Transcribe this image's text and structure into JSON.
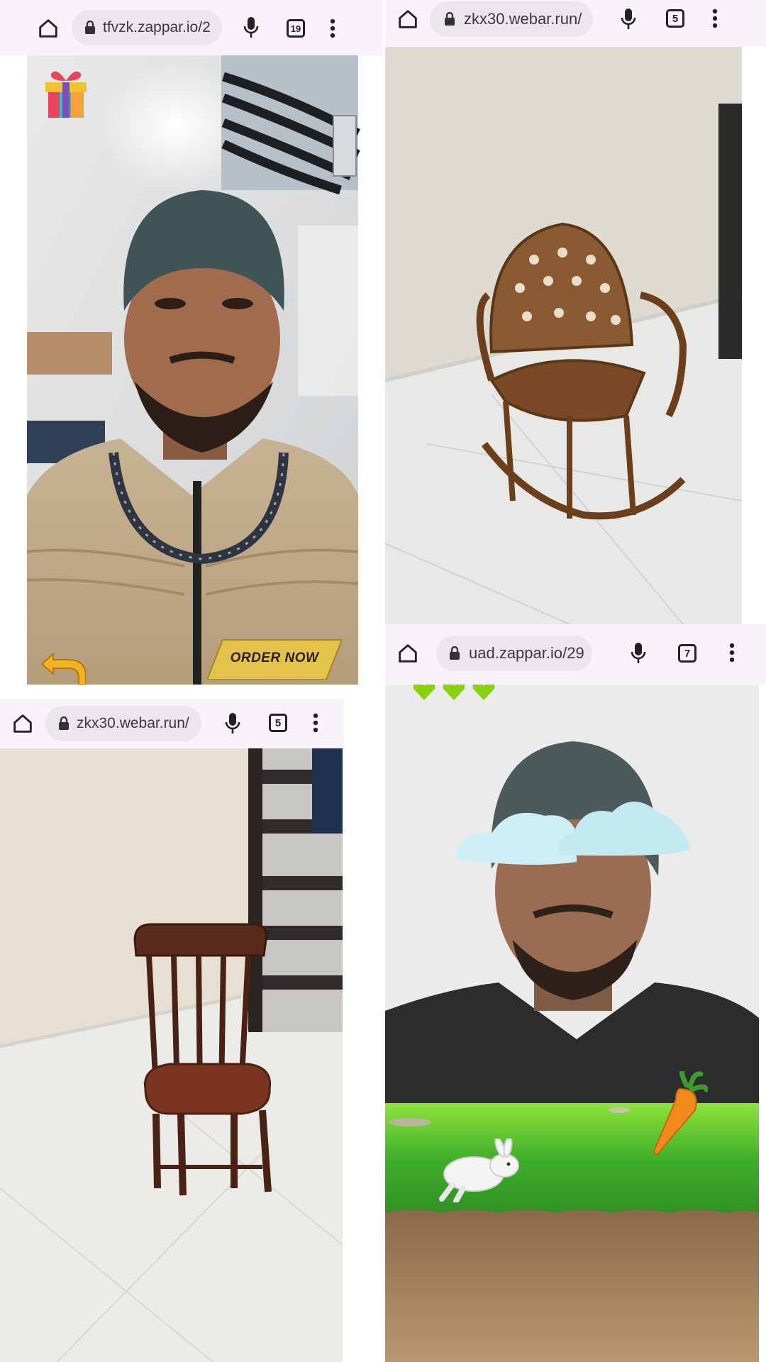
{
  "panels": [
    {
      "id": "necklace-tryon",
      "url": "tfvzk.zappar.io/2",
      "tab_count": "19",
      "order_button": "ORDER NOW"
    },
    {
      "id": "rocking-chair",
      "url": "zkx30.webar.run/",
      "tab_count": "5"
    },
    {
      "id": "wooden-chair",
      "url": "zkx30.webar.run/",
      "tab_count": "5"
    },
    {
      "id": "bunny-game",
      "url": "uad.zappar.io/29",
      "tab_count": "7",
      "lives": 3
    }
  ],
  "icons": {
    "home": "home-icon",
    "lock": "lock-icon",
    "mic": "microphone-icon",
    "menu": "more-vert-icon",
    "gift": "gift-icon",
    "back": "back-arrow-icon",
    "heart": "heart-icon",
    "bunny": "bunny-icon",
    "carrot": "carrot-icon"
  },
  "colors": {
    "toolbar_bg": "#f9f3f9",
    "url_pill_bg": "#ebe6ec",
    "order_gold": "#e3c34a",
    "grass_green": "#4cbf2a",
    "heart_green": "#8ad10f"
  }
}
